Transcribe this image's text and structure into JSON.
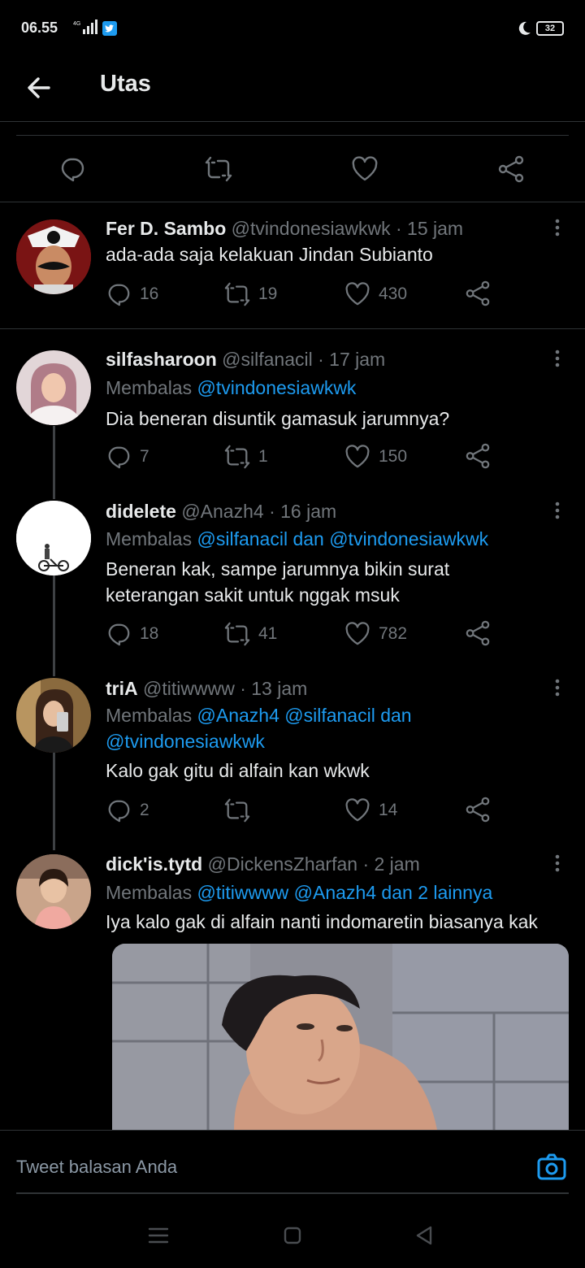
{
  "status_bar": {
    "time": "06.55",
    "battery": "32",
    "network": "4G"
  },
  "header": {
    "title": "Utas"
  },
  "icons": {
    "back": "arrow-left-icon",
    "reply": "speech-bubble-icon",
    "retweet": "retweet-icon",
    "like": "heart-icon",
    "share": "share-icon",
    "more": "vertical-dots-icon",
    "camera": "camera-icon"
  },
  "colors": {
    "accent": "#1d9bf0",
    "muted": "#71767b",
    "background": "#000000"
  },
  "tweets": [
    {
      "name": "Fer D. Sambo",
      "handle": "@tvindonesiawkwk",
      "time": "15 jam",
      "text": "ada-ada saja kelakuan Jindan Subianto",
      "replies": "16",
      "retweets": "19",
      "likes": "430"
    },
    {
      "name": "silfasharoon",
      "handle": "@silfanacil",
      "time": "17 jam",
      "reply_prefix": "Membalas",
      "reply_mentions": "@tvindonesiawkwk",
      "text": "Dia beneran disuntik gamasuk jarumnya?",
      "replies": "7",
      "retweets": "1",
      "likes": "150"
    },
    {
      "name": "didelete",
      "handle": "@Anazh4",
      "time": "16 jam",
      "reply_prefix": "Membalas",
      "reply_mentions": "@silfanacil dan @tvindonesiawkwk",
      "text_line1": "Beneran kak, sampe jarumnya bikin surat",
      "text_line2": "keterangan sakit untuk nggak msuk",
      "replies": "18",
      "retweets": "41",
      "likes": "782"
    },
    {
      "name": "triA",
      "handle": "@titiwwww",
      "time": "13 jam",
      "reply_prefix": "Membalas",
      "reply_mentions_line1": "@Anazh4 @silfanacil dan",
      "reply_mentions_line2": "@tvindonesiawkwk",
      "text": "Kalo gak gitu di alfain kan wkwk",
      "replies": "2",
      "retweets": "",
      "likes": "14"
    },
    {
      "name": "dick'is.tytd",
      "handle": "@DickensZharfan",
      "time": "2 jam",
      "reply_prefix": "Membalas",
      "reply_mentions": "@titiwwww @Anazh4 dan 2 lainnya",
      "text": "Iya kalo gak di alfain nanti indomaretin biasanya kak"
    }
  ],
  "reply_bar": {
    "placeholder": "Tweet balasan Anda"
  }
}
